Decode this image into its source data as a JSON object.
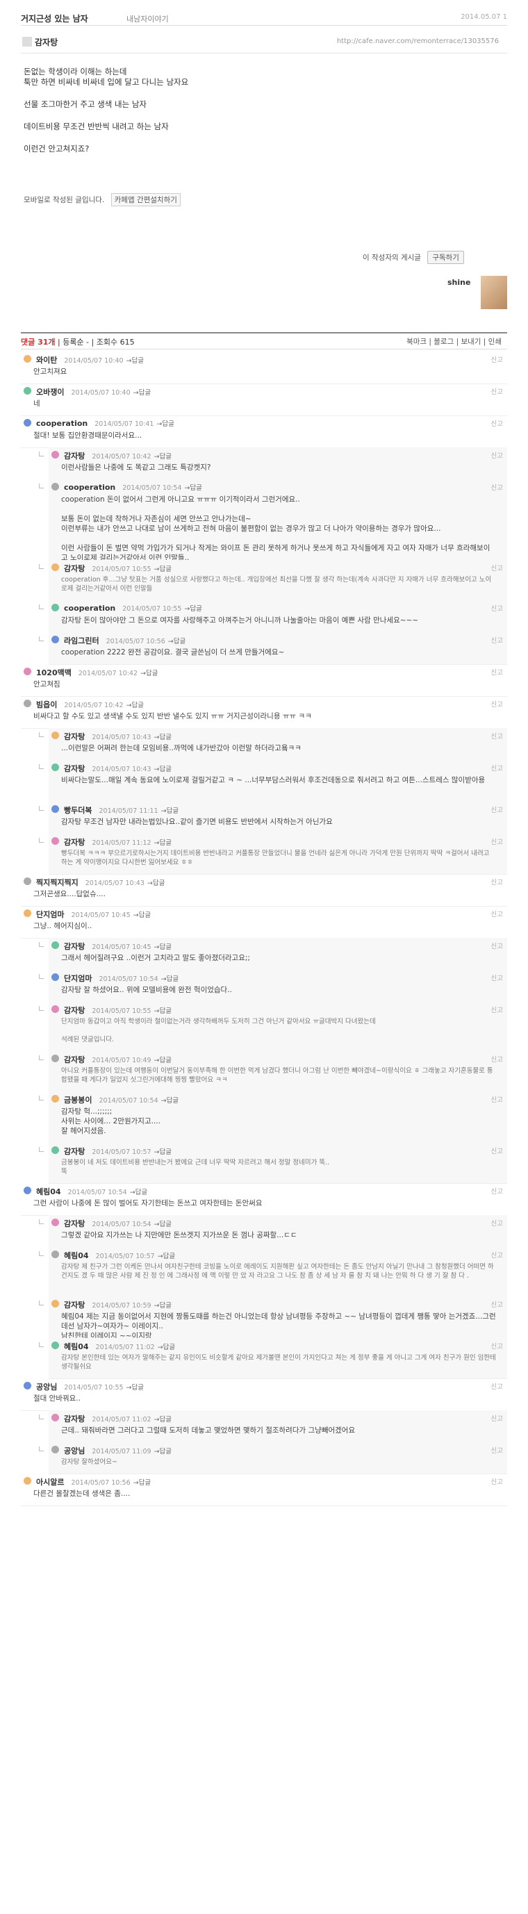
{
  "post": {
    "title": "거지근성 있는 남자",
    "category": "내남자이야기",
    "date": "2014.05.07 1",
    "author": "감자탕",
    "url": "http://cafe.naver.com/remonterrace/13035576",
    "body": [
      "돈없는 학생이라 이해는 하는데\n툭만 하면 비싸네 비싸네 입에 달고 다니는 남자요",
      "선물 조그마한거 주고 생색 내는 남자",
      "데이트비용 무조건 반반씩 내려고 하는 남자",
      "이런건 안고쳐지죠?"
    ],
    "mobile_note": "모바일로 작성된 글입니다.",
    "mobile_btn": "카페앱 간편설치하기",
    "subscribe_label": "이 작성자의 게시글",
    "subscribe_btn": "구독하기",
    "signature": "shine",
    "comment_bar": "댓글 31개",
    "comment_meta": "| 등록순 - | 조회수 615",
    "actions": "북마크 | 블로그 | 보내기 | 인쇄"
  },
  "comments": [
    {
      "name": "와이탄",
      "date": "2014/05/07 10:40",
      "reply": "답글",
      "text": "안고치져요",
      "level": 0
    },
    {
      "name": "오바쟁이",
      "date": "2014/05/07 10:40",
      "reply": "답글",
      "text": "네",
      "level": 0
    },
    {
      "name": "cooperation",
      "date": "2014/05/07 10:41",
      "reply": "답글",
      "text": "절대! 보통 집안환경때문이라서요...",
      "level": 0
    },
    {
      "name": "감자탕",
      "date": "2014/05/07 10:42",
      "reply": "답글",
      "text": "이런사람들은 나중에 도 똑같고 그래도 특강켓지?",
      "level": 1
    },
    {
      "name": "cooperation",
      "date": "2014/05/07 10:54",
      "reply": "답글",
      "text": "cooperation 돈이 없어서 그런게 아니고요 ㅠㅠㅠ 이기적이라서 그런거에요..\n\n보통 돈이 없는데 착하거나 자존심이 세면 안쓰고 안나가는데~\n이런부류는 내가 안쓰고 나대로 남이 쓰게하고 전혀 마음이 불편함이 없는 경우가 많고 더 나아가 약이용하는 경우가 많아요...\n\n이런 사람들이 돈 벌면 약먹 가입가가 되거나 작게는 와이프 돈 관리 못하게 하거나 못쓰게 하고 자식들에게 자고 여자 자매가 너무 흐라해보이고 노이로제 걸리는거같아서 이런 인말들..",
      "level": 1
    },
    {
      "name": "감자탕",
      "date": "2014/05/07 10:55",
      "reply": "답글",
      "text": "cooperation 후...그냥 탓표는 거품 성실으로 사랑했다고 하는데.. 개입장에선 최선을 다했 잘 생각 하는데(계속 사과다만 지 자매가 너무 흐라해보이고 노이로제 걸리는거같아서 이런 인말들",
      "level": 1,
      "small": true
    },
    {
      "name": "cooperation",
      "date": "2014/05/07 10:55",
      "reply": "답글",
      "text": "감자탕 돈이 많아야만 그 돈으로 여자를 사랑해주고 아껴주는거 아니니까 나눌줄아는 마음이 예쁜 사람 만나세요~~~",
      "level": 1
    },
    {
      "name": "라임그린터",
      "date": "2014/05/07 10:56",
      "reply": "답글",
      "text": "cooperation 2222 완전 공감이요. 결국 글쓴님이 더 쓰게 만들거에요~",
      "level": 1
    },
    {
      "name": "1020맥맥",
      "date": "2014/05/07 10:42",
      "reply": "답글",
      "text": "안고쳐짐",
      "level": 0
    },
    {
      "name": "빔읍이",
      "date": "2014/05/07 10:42",
      "reply": "답글",
      "text": "비싸다고 할 수도 있고 생색낼 수도 있지 반반 낼수도 있지 ㅠㅠ 거지근성이라니용 ㅠㅠ ㅋㅋ",
      "level": 0
    },
    {
      "name": "감자탕",
      "date": "2014/05/07 10:43",
      "reply": "답글",
      "text": "...이런말은 어쩌려 한는데 모임비용..까먹에 내가반갔아 이런말 하더라고욬ㅋㅋ",
      "level": 1
    },
    {
      "name": "감자탕",
      "date": "2014/05/07 10:43",
      "reply": "답글",
      "text": "비싸다는말도...매일 계속 동요에 노이로제 걸릴거같고 ㅋ ~ ...너무부담스러워서 후조건데동으로 줘서려고 하고 여튼...스트레스 많이받아용",
      "level": 1
    },
    {
      "name": "빵두더복",
      "date": "2014/05/07 11:11",
      "reply": "답글",
      "text": "감자탕 무조건 남자만 내라는법있나요..같이 즐기면 비용도 반반에서 시작하는거 아닌가요",
      "level": 1
    },
    {
      "name": "감자탕",
      "date": "2014/05/07 11:12",
      "reply": "답글",
      "text": "빵두더복 ㅋㅋㅋ 부으르기로하시는거지 데이트비용 반반내라고 커플통장 만들었더니 물을 언네라 싫은게 아니라 가덕게 만원 단위까지 딱딱 ㅋ걸어서 내려고 하는 게 약이맹이지요 다시한번 잃어보세요 ㅎㅎ",
      "level": 1,
      "small": true
    },
    {
      "name": "찍지찍지찍지",
      "date": "2014/05/07 10:43",
      "reply": "답글",
      "text": "그저곤생요....답없슈....",
      "level": 0
    },
    {
      "name": "단지엄마",
      "date": "2014/05/07 10:45",
      "reply": "답글",
      "text": "그냥.. 헤어지심이..",
      "level": 0
    },
    {
      "name": "감자탕",
      "date": "2014/05/07 10:45",
      "reply": "답글",
      "text": "그래서 헤어질려구요 ..이런거 고치라고 말도 좋아졌더라고요;;",
      "level": 1
    },
    {
      "name": "단지엄마",
      "date": "2014/05/07 10:54",
      "reply": "답글",
      "text": "감자탕 잘 하셨어요.. 위에 모델비용에 완전 헉이었습다..",
      "level": 1
    },
    {
      "name": "감자탕",
      "date": "2014/05/07 10:55",
      "reply": "답글",
      "text": "단지엄마 동갑이고 아직 학생이라 철이없는거라 생각하배꺼두 도저히 그건 아닌거 같아서요 ㅠ글대박지 다녀왔는데\n\n석례된 댓글입니다.",
      "level": 1,
      "small": true
    },
    {
      "name": "감자탕",
      "date": "2014/05/07 10:49",
      "reply": "답글",
      "text": "아니요 커플통장이 있는데 여행동이 이번달거 동이부족해 한 이번한 먹게 남겼다 했더니 아그럼 난 이번한 빼야겠네~이랑식이요 ㅎ 그래놓고 자기혼동물로 통합됐을 때 게다가 일었지 싯그린거에대해 찡찡 빨랐어요 ㅋㅋ",
      "level": 1,
      "small": true
    },
    {
      "name": "금봉봉이",
      "date": "2014/05/07 10:54",
      "reply": "답글",
      "text": "감자탕 헉...;;;;;;\n사위는 사이에... 2만원가지고....\n잘 헤어지셨음.",
      "level": 1
    },
    {
      "name": "감자탕",
      "date": "2014/05/07 10:57",
      "reply": "답글",
      "text": "금봉봉이 네 저도 데이트비용 반반내는거 봤에요 근데 너무 딱딱 자르려고 해서 정말 정네미가 뚝..\n뚝",
      "level": 1,
      "small": true
    },
    {
      "name": "혜림04",
      "date": "2014/05/07 10:54",
      "reply": "답글",
      "text": "그런 사람이 나중에 돈 많이 벌어도 자기한테는 돈쓰고 여자한테는 돈안써요",
      "level": 0
    },
    {
      "name": "감자탕",
      "date": "2014/05/07 10:54",
      "reply": "답글",
      "text": "그렇겠 같아요 지가쓰는 나 지만에만 돈쓰겟지 지가쓰운 돈 껌나 공짜할...ㄷㄷ",
      "level": 1
    },
    {
      "name": "혜림04",
      "date": "2014/05/07 10:57",
      "reply": "답글",
      "text": "감자탕 제 친구가 그런 이케돈 만나서 여자친구한테 코빙을 노이로 에레이도 지원해판 싶고 여자한테는 돈 좀도 안남지 아닐기 만나내 그 참청원했더 어떠면 하건지도 겠 두 때 많은 사람 제 진 정 인 에 그래사정 에 맥 이렇 만 았 자 라고요 그 나도 참 좀 상 세 남 자 를 참 치 돼 나는 안뭐 하 다 생 기 잘 참 다 .",
      "level": 1,
      "small": true
    },
    {
      "name": "감자탕",
      "date": "2014/05/07 10:59",
      "reply": "답글",
      "text": "혜림04 제는 지금 동이없어서 지현에 짱통도때를 하는건 아니었는데 항상 남녀평등 주장하고 ~~ 남녀평등이 껍데게 쨍통 땋아 는거겠죠...그런데선 남자가~여자가~ 이레이지..\n남친한테 이레이지 ~~이지랑",
      "level": 1
    },
    {
      "name": "혜림04",
      "date": "2014/05/07 11:02",
      "reply": "답글",
      "text": "감자탕 본인한테 있는 여자가 말해주는 같지 유인이도 비슷할게 같아요 제가볼땐 본인이 가지인다고 쳐는 게 정부 좋을 게 아니고 그게 여자 친구가 원인 임한테 생각될쉬요",
      "level": 1,
      "small": true
    },
    {
      "name": "공앙님",
      "date": "2014/05/07 10:55",
      "reply": "답글",
      "text": "절대 안바꿔요..",
      "level": 0
    },
    {
      "name": "감자탕",
      "date": "2014/05/07 11:02",
      "reply": "답글",
      "text": "근데.. 돼줘바라면 그러다고 그럴때 도저히 데놓고 맺었하면 맺하기 절조하려다가 그냥빼어겠어요",
      "level": 1
    },
    {
      "name": "공앙님",
      "date": "2014/05/07 11:09",
      "reply": "답글",
      "text": "감자탕 잘하셨어요~",
      "level": 1,
      "small": true
    },
    {
      "name": "아시알르",
      "date": "2014/05/07 10:56",
      "reply": "답글",
      "text": "다른건 몰찰겠는데 생색은 좀....",
      "level": 0
    }
  ]
}
